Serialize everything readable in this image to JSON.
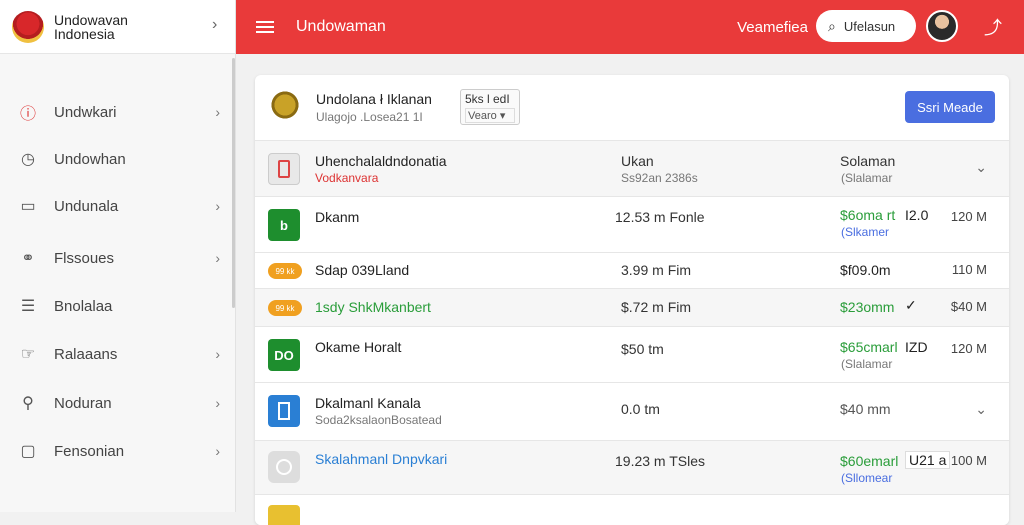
{
  "brand": {
    "line1": "Undowavan",
    "line2": "Indonesia"
  },
  "sidebar": {
    "items": [
      {
        "label": "Undwkari",
        "icon": "alert-circle-icon",
        "glyph": "ⓘ",
        "chevron": true
      },
      {
        "label": "Undowhan",
        "icon": "clock-icon",
        "glyph": "◷",
        "chevron": false
      },
      {
        "label": "Undunala",
        "icon": "monitor-icon",
        "glyph": "▭",
        "chevron": true
      },
      {
        "label": "Flssoues",
        "icon": "users-icon",
        "glyph": "⚭",
        "chevron": true
      },
      {
        "label": "Bnolalaa",
        "icon": "document-icon",
        "glyph": "☰",
        "chevron": false
      },
      {
        "label": "Ralaaans",
        "icon": "hand-icon",
        "glyph": "☞",
        "chevron": true
      },
      {
        "label": "Noduran",
        "icon": "user-icon",
        "glyph": "⚲",
        "chevron": true
      },
      {
        "label": "Fensonian",
        "icon": "square-icon",
        "glyph": "▢",
        "chevron": true
      }
    ]
  },
  "topbar": {
    "title": "Undowaman",
    "right_label": "Veamefiea",
    "search_label": "Ufelasun",
    "accent": "#e93a3a"
  },
  "card": {
    "title": "Undolana ł Iklanan",
    "subtitle": "Ulagojo .Losea21 1I",
    "select_value": "5ks l edI",
    "select_option": "Vearo",
    "button_label": "Ssri Meade",
    "rows": [
      {
        "name": "Uhenchalaldndonatia",
        "sub": "Vodkanvara",
        "c2": "Ukan",
        "c2sub": "Ss92an 2386s",
        "c3": "Solaman",
        "c3sub": "(Slalamar",
        "chev": true
      },
      {
        "badge": "b",
        "name": "Dkanm",
        "c2": "12.53 m Fonle",
        "c3": "$6oma rt",
        "c3sub": "(Slkamer",
        "tag": "I2.0",
        "c4": "120 M"
      },
      {
        "pill": "99 kk",
        "name": "Sdap 039Lland",
        "c2": "3.99 m Fim",
        "c3": "$f09.0m",
        "c4": "110 M"
      },
      {
        "pill": "99 kk",
        "name": "1sdy ShkMkanbert",
        "c2": "$.72 m Fim",
        "c3": "$23omm",
        "tag": "✓",
        "c4": "$40 M"
      },
      {
        "badge": "DO",
        "name": "Okame Horalt",
        "c2": "$50 tm",
        "c3": "$65cmarl",
        "c3sub": "(Slalamar",
        "tag": "IZD",
        "c4": "120 M"
      },
      {
        "name": "Dkalmanl Kanala",
        "sub": "Soda2ksalaonBosatead",
        "c2": "0.0 tm",
        "c3": "$40 mm",
        "chev": true
      },
      {
        "name": "Skalahmanl Dnpvkari",
        "c2": "19.23 m TSles",
        "c3": "$60emarl",
        "c3sub": "(Sllomear",
        "tag": "U21 a",
        "c4": "100 M"
      }
    ]
  }
}
